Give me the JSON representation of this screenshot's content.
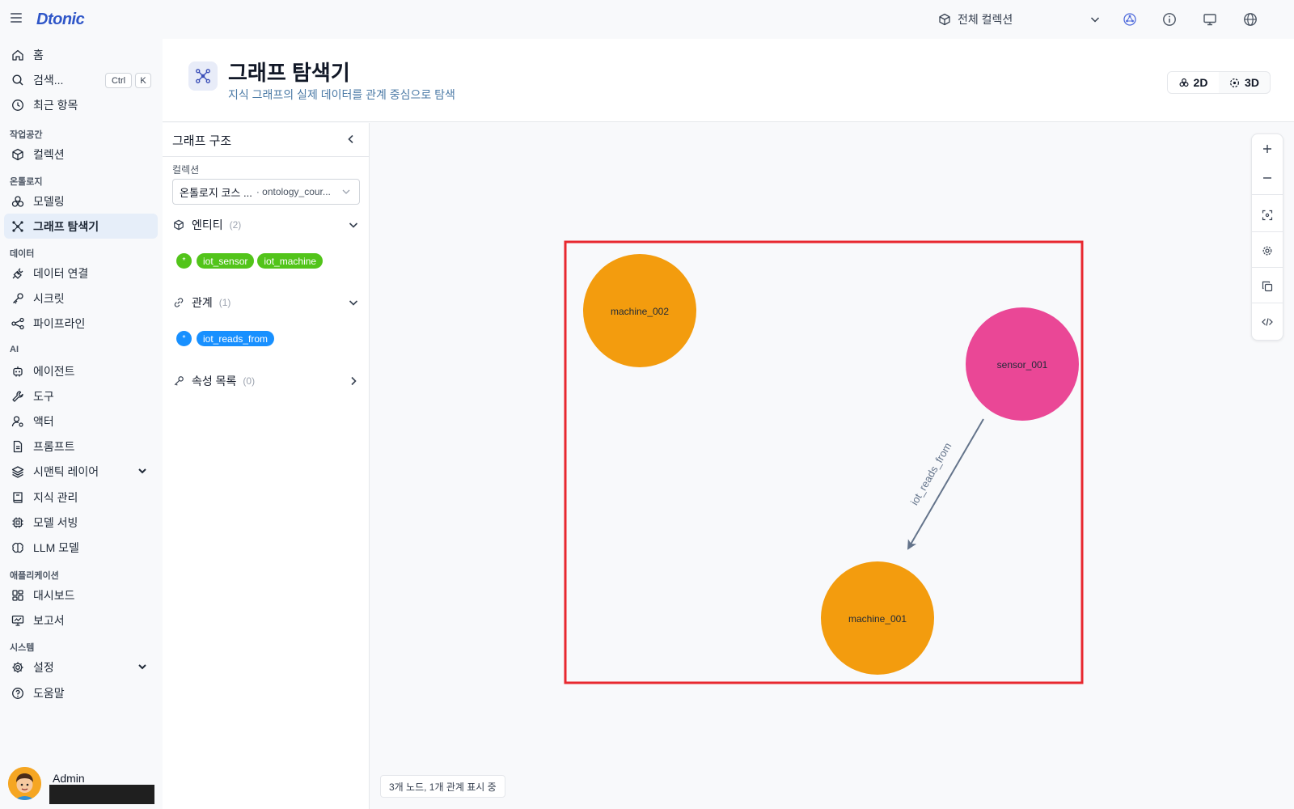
{
  "app": {
    "logo": "Dtonic",
    "collection_selector": "전체 컬렉션"
  },
  "topbar": {
    "icons": [
      "graph-icon",
      "info-icon",
      "monitor-icon",
      "globe-icon"
    ]
  },
  "sidebar": {
    "home": "홈",
    "search": "검색...",
    "kbd_ctrl": "Ctrl",
    "kbd_k": "K",
    "recent": "최근 항목",
    "sections": {
      "workspace": "작업공간",
      "ontology": "온톨로지",
      "data": "데이터",
      "ai": "AI",
      "applications": "애플리케이션",
      "system": "시스템"
    },
    "items": {
      "collections": "컬렉션",
      "modeling": "모델링",
      "graph_explorer": "그래프 탐색기",
      "data_connection": "데이터 연결",
      "secrets": "시크릿",
      "pipeline": "파이프라인",
      "agents": "에이전트",
      "tools": "도구",
      "actors": "액터",
      "prompts": "프롬프트",
      "semantic_layer": "시맨틱 레이어",
      "knowledge": "지식 관리",
      "model_serving": "모델 서빙",
      "llm_models": "LLM 모델",
      "dashboard": "대시보드",
      "reports": "보고서",
      "settings": "설정",
      "help": "도움말"
    },
    "user_name": "Admin"
  },
  "header": {
    "title": "그래프 탐색기",
    "subtitle": "지식 그래프의 실제 데이터를 관계 중심으로 탐색",
    "view_2d": "2D",
    "view_3d": "3D",
    "selected_view": "2D"
  },
  "panel": {
    "title": "그래프 구조",
    "collection_label": "컬렉션",
    "collection_value": "온톨로지 코스 ...",
    "collection_id": "· ontology_cour...",
    "entities_label": "엔티티",
    "entities_count": "(2)",
    "entities": [
      "iot_sensor",
      "iot_machine"
    ],
    "relations_label": "관계",
    "relations_count": "(1)",
    "relations": [
      "iot_reads_from"
    ],
    "properties_label": "속성 목록",
    "properties_count": "(0)"
  },
  "graph": {
    "nodes": [
      {
        "id": "machine_002",
        "type": "iot_machine",
        "color": "#f39c0e"
      },
      {
        "id": "sensor_001",
        "type": "iot_sensor",
        "color": "#ea4796"
      },
      {
        "id": "machine_001",
        "type": "iot_machine",
        "color": "#f39c0e"
      }
    ],
    "edges": [
      {
        "source": "sensor_001",
        "target": "machine_001",
        "label": "iot_reads_from"
      }
    ],
    "highlight_color": "#e8282f"
  },
  "colors": {
    "entity_chip": "#52c41a",
    "relation_chip": "#1890ff",
    "accent": "#2f56c8",
    "edge": "#64748b"
  },
  "status": "3개 노드, 1개 관계 표시 중"
}
